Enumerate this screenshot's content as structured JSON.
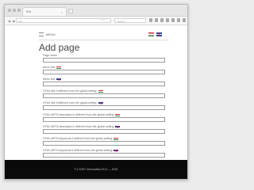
{
  "browser": {
    "tab_label": "Edit",
    "tab_close": "×",
    "url": "Edit",
    "search_placeholder": "Search",
    "nav_arrows": "◀ ▶",
    "url_icons": "☆ ⟳"
  },
  "header": {
    "menu_label": "MENU",
    "languages": [
      {
        "code": "hu",
        "icon": "hungary-flag-icon"
      },
      {
        "code": "en",
        "icon": "uk-flag-icon"
      }
    ]
  },
  "page": {
    "title": "Add page"
  },
  "fields": [
    {
      "label": "Page name",
      "flag": null,
      "value": ""
    },
    {
      "label": "Menu text",
      "flag": "hu",
      "value": ""
    },
    {
      "label": "Menu text",
      "flag": "en",
      "value": ""
    },
    {
      "label": "HTML title if different from the global setting",
      "flag": "hu",
      "value": ""
    },
    {
      "label": "HTML title if different from the global setting",
      "flag": "en",
      "value": ""
    },
    {
      "label": "HTML META description if different from the global setting",
      "flag": "hu",
      "value": ""
    },
    {
      "label": "HTML META description if different from the global setting",
      "flag": "en",
      "value": ""
    },
    {
      "label": "HTML META keywords if different from the global setting",
      "flag": "hu",
      "value": ""
    },
    {
      "label": "HTML META keywords if different from the global setting",
      "flag": "en",
      "value": ""
    }
  ],
  "footer": {
    "text": "© LYNET Informatika 2014 — 2015"
  }
}
